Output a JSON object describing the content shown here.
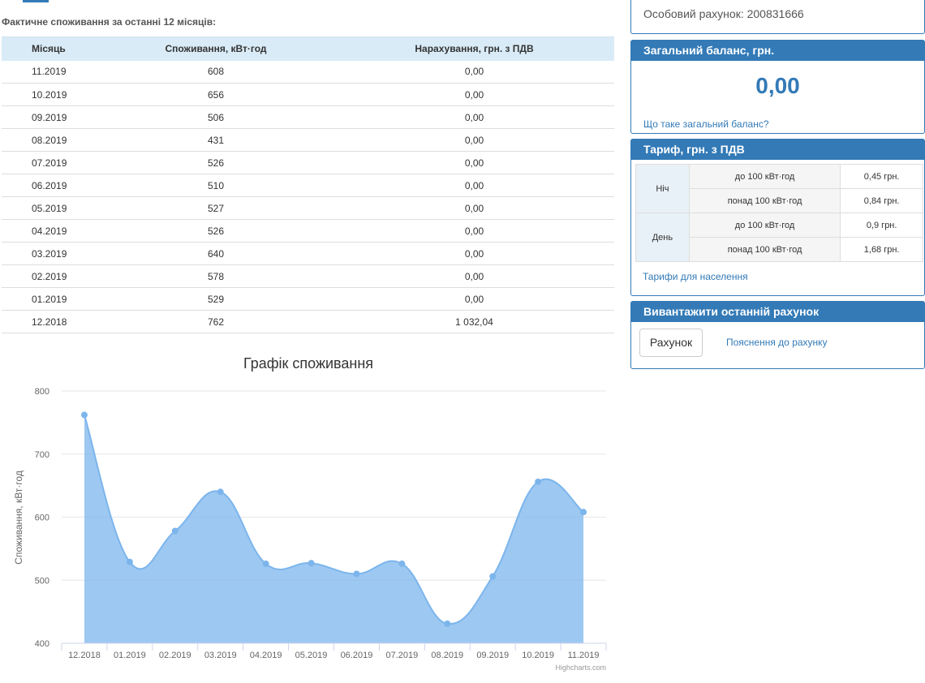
{
  "section_title": "Фактичне споживання за останні 12 місяців:",
  "consumption_table": {
    "headers": [
      "Місяць",
      "Споживання, кВт·год",
      "Нарахування, грн. з ПДВ"
    ],
    "rows": [
      [
        "11.2019",
        "608",
        "0,00"
      ],
      [
        "10.2019",
        "656",
        "0,00"
      ],
      [
        "09.2019",
        "506",
        "0,00"
      ],
      [
        "08.2019",
        "431",
        "0,00"
      ],
      [
        "07.2019",
        "526",
        "0,00"
      ],
      [
        "06.2019",
        "510",
        "0,00"
      ],
      [
        "05.2019",
        "527",
        "0,00"
      ],
      [
        "04.2019",
        "526",
        "0,00"
      ],
      [
        "03.2019",
        "640",
        "0,00"
      ],
      [
        "02.2019",
        "578",
        "0,00"
      ],
      [
        "01.2019",
        "529",
        "0,00"
      ],
      [
        "12.2018",
        "762",
        "1 032,04"
      ]
    ]
  },
  "chart_data": {
    "type": "area",
    "title": "Графік споживання",
    "ylabel": "Споживання, кВт·год",
    "xlabel": "",
    "categories": [
      "12.2018",
      "01.2019",
      "02.2019",
      "03.2019",
      "04.2019",
      "05.2019",
      "06.2019",
      "07.2019",
      "08.2019",
      "09.2019",
      "10.2019",
      "11.2019"
    ],
    "values": [
      762,
      529,
      578,
      640,
      526,
      527,
      510,
      526,
      431,
      506,
      656,
      608
    ],
    "ylim": [
      400,
      800
    ],
    "yticks": [
      400,
      500,
      600,
      700,
      800
    ],
    "grid": true,
    "credits": "Highcharts.com",
    "color": "#7cb5ec"
  },
  "account": {
    "text": "Особовий рахунок: 200831666"
  },
  "balance": {
    "header": "Загальний баланс, грн.",
    "value": "0,00",
    "link": "Що таке загальний баланс?"
  },
  "tariff": {
    "header": "Тариф, грн. з ПДВ",
    "periods": [
      {
        "name": "Ніч",
        "rows": [
          {
            "range": "до 100 кВт·год",
            "price": "0,45 грн."
          },
          {
            "range": "понад 100 кВт·год",
            "price": "0,84 грн."
          }
        ]
      },
      {
        "name": "День",
        "rows": [
          {
            "range": "до 100 кВт·год",
            "price": "0,9 грн."
          },
          {
            "range": "понад 100 кВт·год",
            "price": "1,68 грн."
          }
        ]
      }
    ],
    "link": "Тарифи для населення"
  },
  "bill": {
    "header": "Вивантажити останній рахунок",
    "button": "Рахунок",
    "link": "Пояснення до рахунку"
  },
  "colors": {
    "primary": "#337ab7",
    "table_header_bg": "#d9ebf6",
    "series": "#7cb5ec"
  }
}
